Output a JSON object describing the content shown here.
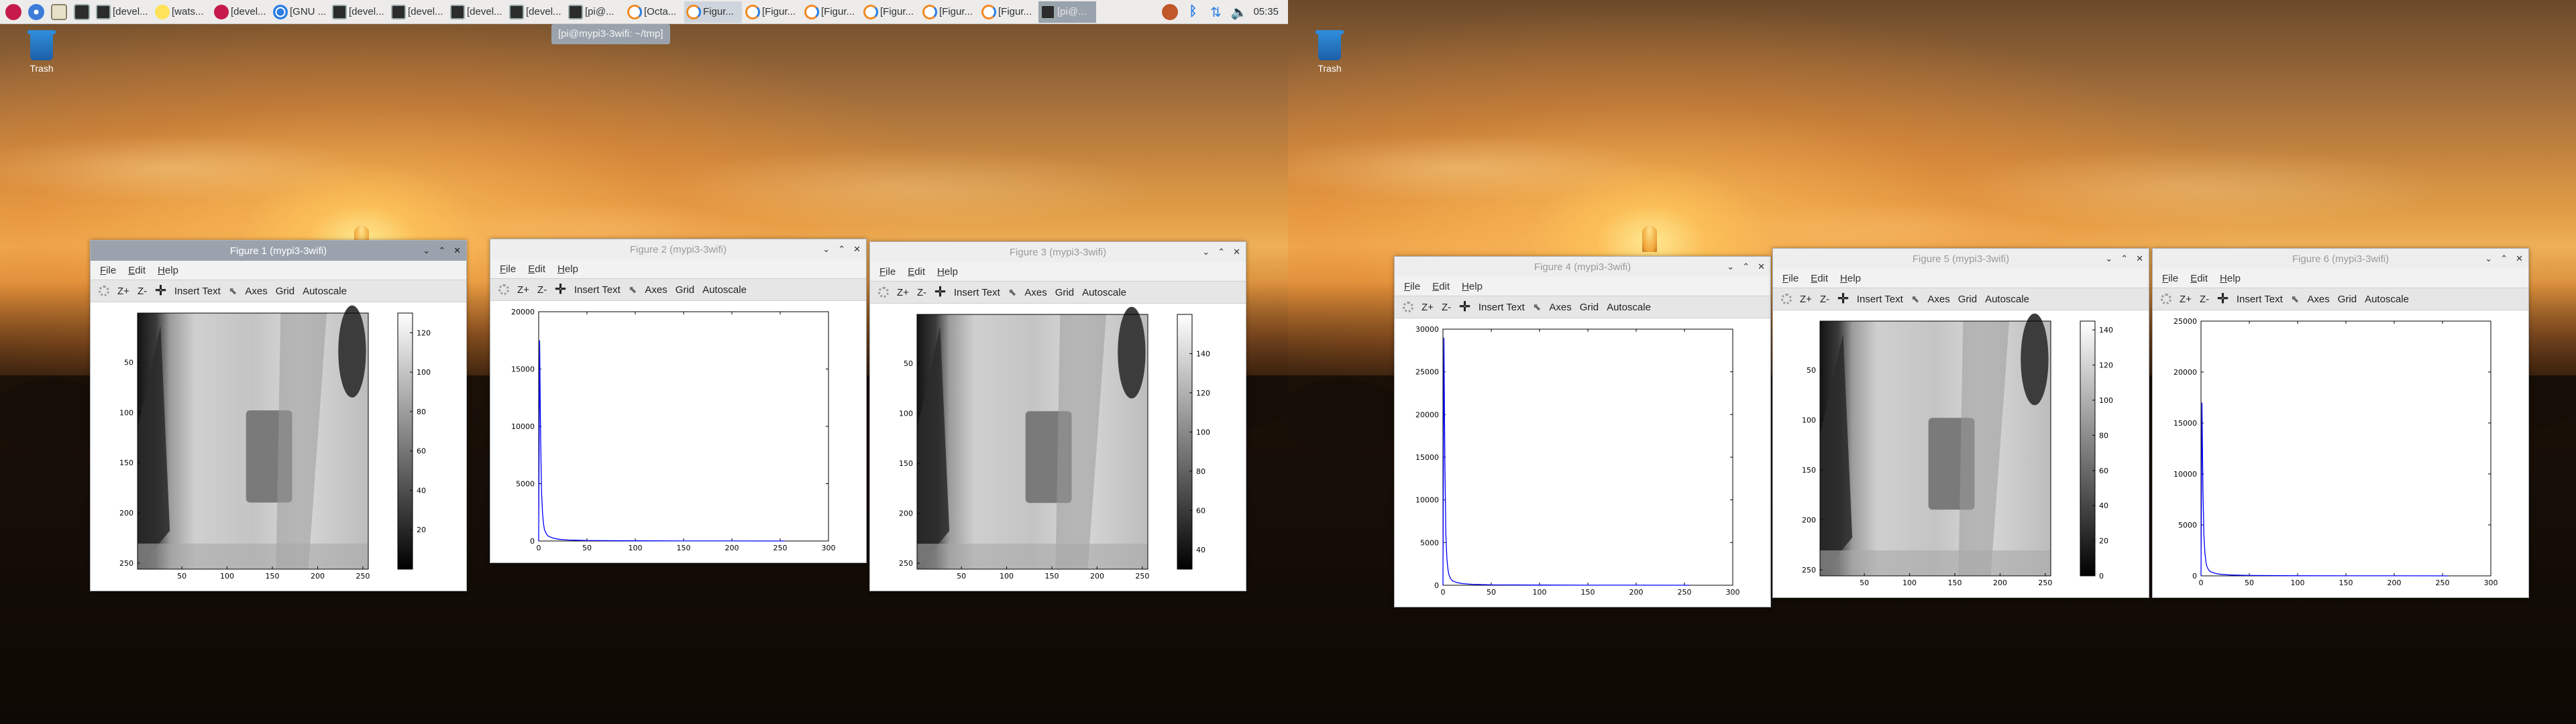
{
  "taskbar": {
    "tasks": [
      {
        "label": "[devel...",
        "icon": "terminal-icon"
      },
      {
        "label": "[wats...",
        "icon": "watson-icon"
      },
      {
        "label": "[devel...",
        "icon": "raspberry-icon"
      },
      {
        "label": "[GNU ...",
        "icon": "chromium-icon"
      },
      {
        "label": "[devel...",
        "icon": "terminal-icon"
      },
      {
        "label": "[devel...",
        "icon": "terminal-icon"
      },
      {
        "label": "[devel...",
        "icon": "terminal-icon"
      },
      {
        "label": "[devel...",
        "icon": "terminal-icon"
      },
      {
        "label": "[pi@...",
        "icon": "terminal-icon"
      },
      {
        "label": "[Octa...",
        "icon": "octave-icon"
      },
      {
        "label": "Figur...",
        "icon": "octave-icon"
      },
      {
        "label": "[Figur...",
        "icon": "octave-icon"
      },
      {
        "label": "[Figur...",
        "icon": "octave-icon"
      },
      {
        "label": "[Figur...",
        "icon": "octave-icon"
      },
      {
        "label": "[Figur...",
        "icon": "octave-icon"
      },
      {
        "label": "[Figur...",
        "icon": "octave-icon"
      },
      {
        "label": "[pi@...",
        "icon": "terminal-icon"
      }
    ],
    "clock": "05:35",
    "tooltip": "[pi@mypi3-3wifi: ~/tmp]"
  },
  "desktop": {
    "trash_label": "Trash"
  },
  "menu": {
    "file": "File",
    "edit": "Edit",
    "help": "Help"
  },
  "toolbar": {
    "zoom_in": "Z+",
    "zoom_out": "Z-",
    "insert_text": "Insert Text",
    "axes": "Axes",
    "grid": "Grid",
    "autoscale": "Autoscale"
  },
  "windows": [
    {
      "title": "Figure 1 (mypi3-3wifi)",
      "active": true
    },
    {
      "title": "Figure 2 (mypi3-3wifi)",
      "active": false
    },
    {
      "title": "Figure 3 (mypi3-3wifi)",
      "active": false
    },
    {
      "title": "Figure 4 (mypi3-3wifi)",
      "active": false
    },
    {
      "title": "Figure 5 (mypi3-3wifi)",
      "active": false
    },
    {
      "title": "Figure 6 (mypi3-3wifi)",
      "active": false
    }
  ],
  "chart_data": [
    {
      "figure": 1,
      "type": "heatmap",
      "colormap": "gray",
      "xticks": [
        50,
        100,
        150,
        200,
        250
      ],
      "yticks": [
        50,
        100,
        150,
        200,
        250
      ],
      "xlim": [
        1,
        256
      ],
      "ylim": [
        1,
        256
      ],
      "colorbar": {
        "ticks": [
          20,
          40,
          60,
          80,
          100,
          120
        ],
        "range": [
          0,
          130
        ]
      }
    },
    {
      "figure": 2,
      "type": "line",
      "color": "#0000ff",
      "xlim": [
        0,
        300
      ],
      "ylim": [
        0,
        20000
      ],
      "xticks": [
        0,
        50,
        100,
        150,
        200,
        250,
        300
      ],
      "yticks": [
        0,
        5000,
        10000,
        15000,
        20000
      ],
      "series": [
        {
          "x": [
            0,
            1,
            2,
            3,
            4,
            5,
            6,
            8,
            10,
            15,
            20,
            30,
            50,
            100,
            150,
            200,
            255
          ],
          "y": [
            0,
            17500,
            9000,
            4200,
            2400,
            1500,
            1000,
            600,
            420,
            250,
            160,
            90,
            40,
            15,
            8,
            5,
            0
          ]
        }
      ]
    },
    {
      "figure": 3,
      "type": "heatmap",
      "colormap": "gray",
      "xticks": [
        50,
        100,
        150,
        200,
        250
      ],
      "yticks": [
        50,
        100,
        150,
        200,
        250
      ],
      "xlim": [
        1,
        256
      ],
      "ylim": [
        1,
        256
      ],
      "colorbar": {
        "ticks": [
          40,
          60,
          80,
          100,
          120,
          140
        ],
        "range": [
          30,
          160
        ]
      }
    },
    {
      "figure": 4,
      "type": "line",
      "color": "#0000ff",
      "xlim": [
        0,
        300
      ],
      "ylim": [
        0,
        30000
      ],
      "xticks": [
        0,
        50,
        100,
        150,
        200,
        250,
        300
      ],
      "yticks": [
        0,
        5000,
        10000,
        15000,
        20000,
        25000,
        30000
      ],
      "series": [
        {
          "x": [
            0,
            1,
            2,
            3,
            4,
            5,
            6,
            8,
            10,
            15,
            20,
            30,
            50,
            100,
            150,
            200,
            255
          ],
          "y": [
            0,
            29000,
            14000,
            6000,
            3200,
            2000,
            1300,
            750,
            500,
            300,
            200,
            110,
            50,
            20,
            10,
            6,
            0
          ]
        }
      ]
    },
    {
      "figure": 5,
      "type": "heatmap",
      "colormap": "gray",
      "xticks": [
        50,
        100,
        150,
        200,
        250
      ],
      "yticks": [
        50,
        100,
        150,
        200,
        250
      ],
      "xlim": [
        1,
        256
      ],
      "ylim": [
        1,
        256
      ],
      "colorbar": {
        "ticks": [
          0,
          20,
          40,
          60,
          80,
          100,
          120,
          140
        ],
        "range": [
          0,
          145
        ]
      }
    },
    {
      "figure": 6,
      "type": "line",
      "color": "#0000ff",
      "xlim": [
        0,
        300
      ],
      "ylim": [
        0,
        25000
      ],
      "xticks": [
        0,
        50,
        100,
        150,
        200,
        250,
        300
      ],
      "yticks": [
        0,
        5000,
        10000,
        15000,
        20000,
        25000
      ],
      "series": [
        {
          "x": [
            0,
            1,
            2,
            3,
            4,
            5,
            6,
            8,
            10,
            15,
            20,
            30,
            50,
            100,
            150,
            200,
            255
          ],
          "y": [
            0,
            17000,
            8500,
            4000,
            2300,
            1400,
            950,
            560,
            400,
            240,
            150,
            85,
            38,
            14,
            7,
            4,
            0
          ]
        }
      ]
    }
  ]
}
